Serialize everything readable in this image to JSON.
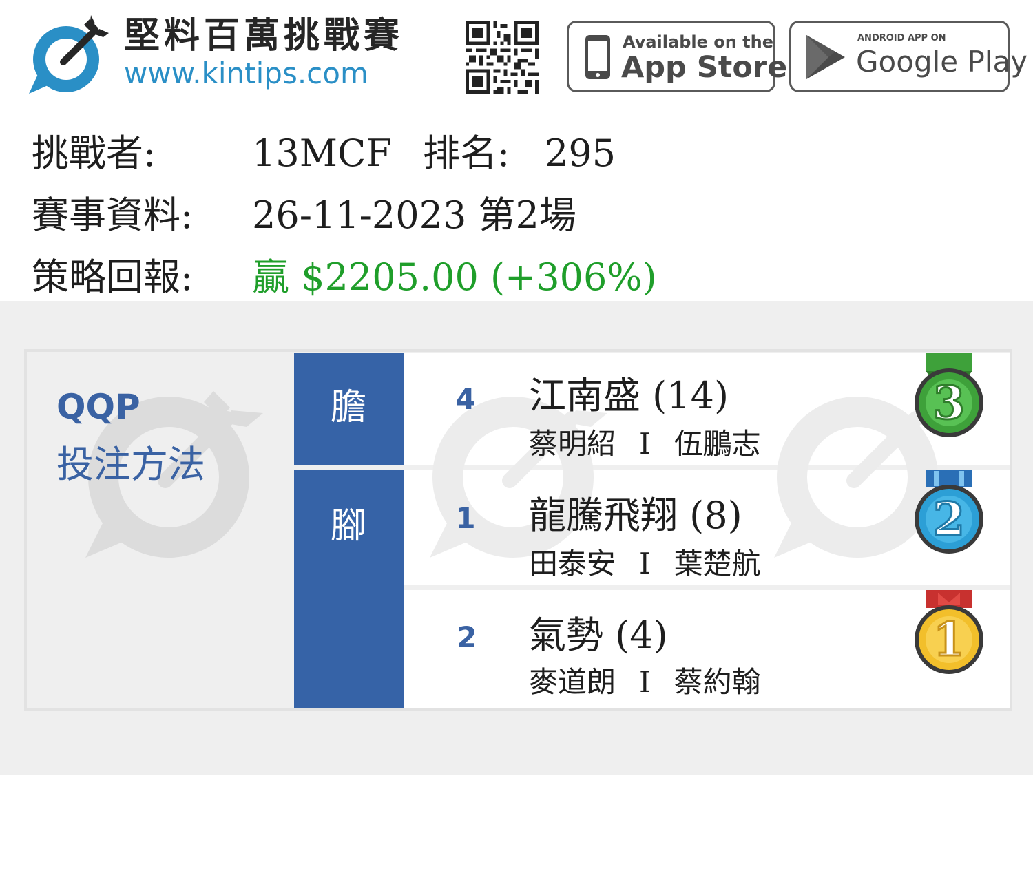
{
  "header": {
    "title": "堅料百萬挑戰賽",
    "url": "www.kintips.com",
    "app_store": {
      "small": "Available on the",
      "big": "App Store"
    },
    "google_play": {
      "small": "ANDROID APP ON",
      "big": "Google Play"
    }
  },
  "challenger": {
    "label": "挑戰者:",
    "value": "13MCF",
    "rank_label": "排名:",
    "rank_value": "295"
  },
  "race_info": {
    "label": "賽事資料:",
    "value": "26-11-2023 第2場"
  },
  "strategy": {
    "label": "策略回報:",
    "value": "贏 $2205.00 (+306%)"
  },
  "bet": {
    "type": "QQP",
    "method": "投注方法"
  },
  "roles": {
    "banker": "膽",
    "legs": "腳"
  },
  "entries": [
    {
      "number": "4",
      "horse": "江南盛 (14)",
      "jockey": "蔡明紹",
      "separator": "I",
      "trainer": "伍鵬志",
      "placing": 3,
      "medal_color": "#3ea13a"
    },
    {
      "number": "1",
      "horse": "龍騰飛翔 (8)",
      "jockey": "田泰安",
      "separator": "I",
      "trainer": "葉楚航",
      "placing": 2,
      "medal_color": "#2c9fd6"
    },
    {
      "number": "2",
      "horse": "氣勢 (4)",
      "jockey": "麥道朗",
      "separator": "I",
      "trainer": "蔡約翰",
      "placing": 1,
      "medal_color": "#f2bf2b"
    }
  ],
  "medal_numbers": [
    "3",
    "2",
    "1"
  ],
  "colors": {
    "accent_blue": "#3663a7",
    "brand_blue": "#2a8fc6",
    "win_green": "#1f9e2a",
    "panel_grey": "#efefef"
  }
}
